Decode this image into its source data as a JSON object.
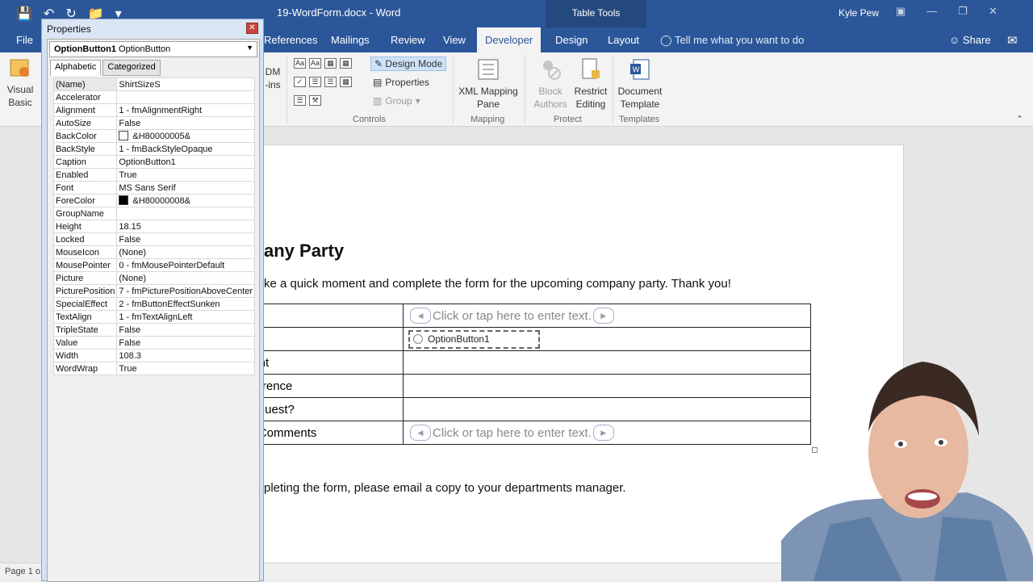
{
  "titlebar": {
    "doc_title": "19-WordForm.docx  -  Word",
    "table_tools": "Table Tools",
    "user": "Kyle Pew"
  },
  "tabs": [
    {
      "label": "File"
    },
    {
      "label": "References"
    },
    {
      "label": "Mailings"
    },
    {
      "label": "Review"
    },
    {
      "label": "View"
    },
    {
      "label": "Developer"
    },
    {
      "label": "Design"
    },
    {
      "label": "Layout"
    }
  ],
  "tellme": "Tell me what you want to do",
  "share": "Share",
  "ribbon": {
    "visual_basic": "Visual Basic",
    "addins_partial": "DM -ins",
    "design_mode": "Design Mode",
    "properties": "Properties",
    "group": "Group",
    "controls_label": "Controls",
    "xml_mapping_pane": "XML Mapping Pane",
    "mapping_label": "Mapping",
    "block_authors": "Block Authors",
    "restrict_editing": "Restrict Editing",
    "protect_label": "Protect",
    "document_template": "Document Template",
    "templates_label": "Templates"
  },
  "document": {
    "heading": "any Party",
    "intro": "ke a quick moment and complete the form for the upcoming company party. Thank you!",
    "rows": [
      {
        "label": "ne",
        "value_type": "text",
        "value": "Click or tap here to enter text."
      },
      {
        "label": "ize",
        "value_type": "option",
        "value": "OptionButton1"
      },
      {
        "label": "nent",
        "value_type": "empty",
        "value": ""
      },
      {
        "label": "eference",
        "value_type": "empty",
        "value": ""
      },
      {
        "label": "a Guest?",
        "value_type": "empty",
        "value": ""
      },
      {
        "label": "al Comments",
        "value_type": "text",
        "value": "Click or tap here to enter text."
      }
    ],
    "footer_para": "pleting the form, please email a copy to your departments manager."
  },
  "statusbar": {
    "page": "Page 1 o"
  },
  "properties": {
    "title": "Properties",
    "object_name": "OptionButton1",
    "object_type": "OptionButton",
    "tab_alphabetic": "Alphabetic",
    "tab_categorized": "Categorized",
    "rows": [
      {
        "name": "(Name)",
        "value": "ShirtSizeS"
      },
      {
        "name": "Accelerator",
        "value": ""
      },
      {
        "name": "Alignment",
        "value": "1 - fmAlignmentRight"
      },
      {
        "name": "AutoSize",
        "value": "False"
      },
      {
        "name": "BackColor",
        "value": "&H80000005&",
        "swatch": "#ffffff"
      },
      {
        "name": "BackStyle",
        "value": "1 - fmBackStyleOpaque"
      },
      {
        "name": "Caption",
        "value": "OptionButton1"
      },
      {
        "name": "Enabled",
        "value": "True"
      },
      {
        "name": "Font",
        "value": "MS Sans Serif"
      },
      {
        "name": "ForeColor",
        "value": "&H80000008&",
        "swatch": "#000000"
      },
      {
        "name": "GroupName",
        "value": ""
      },
      {
        "name": "Height",
        "value": "18.15"
      },
      {
        "name": "Locked",
        "value": "False"
      },
      {
        "name": "MouseIcon",
        "value": "(None)"
      },
      {
        "name": "MousePointer",
        "value": "0 - fmMousePointerDefault"
      },
      {
        "name": "Picture",
        "value": "(None)"
      },
      {
        "name": "PicturePosition",
        "value": "7 - fmPicturePositionAboveCenter"
      },
      {
        "name": "SpecialEffect",
        "value": "2 - fmButtonEffectSunken"
      },
      {
        "name": "TextAlign",
        "value": "1 - fmTextAlignLeft"
      },
      {
        "name": "TripleState",
        "value": "False"
      },
      {
        "name": "Value",
        "value": "False"
      },
      {
        "name": "Width",
        "value": "108.3"
      },
      {
        "name": "WordWrap",
        "value": "True"
      }
    ]
  },
  "colors": {
    "ribbon_blue": "#2b579a",
    "ribbon_body": "#f3f3f3"
  }
}
